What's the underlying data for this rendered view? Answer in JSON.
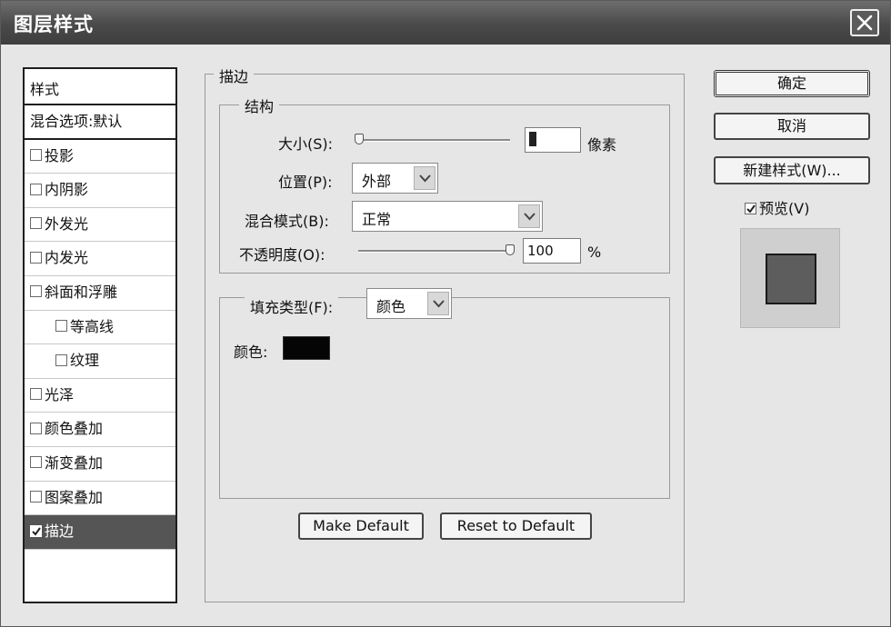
{
  "window": {
    "title": "图层样式"
  },
  "sidebar": {
    "header": "样式",
    "blend_options": "混合选项:默认",
    "items": [
      {
        "label": "投影",
        "checked": false
      },
      {
        "label": "内阴影",
        "checked": false
      },
      {
        "label": "外发光",
        "checked": false
      },
      {
        "label": "内发光",
        "checked": false
      },
      {
        "label": "斜面和浮雕",
        "checked": false
      },
      {
        "label": "等高线",
        "checked": false
      },
      {
        "label": "纹理",
        "checked": false
      },
      {
        "label": "光泽",
        "checked": false
      },
      {
        "label": "颜色叠加",
        "checked": false
      },
      {
        "label": "渐变叠加",
        "checked": false
      },
      {
        "label": "图案叠加",
        "checked": false
      },
      {
        "label": "描边",
        "checked": true
      }
    ]
  },
  "stroke": {
    "group_title": "描边",
    "structure": {
      "title": "结构",
      "size_label": "大小(S):",
      "size_value": "",
      "size_unit": "像素",
      "position_label": "位置(P):",
      "position_value": "外部",
      "blend_label": "混合模式(B):",
      "blend_value": "正常",
      "opacity_label": "不透明度(O):",
      "opacity_value": "100",
      "opacity_unit": "%"
    },
    "fill": {
      "type_label": "填充类型(F):",
      "type_value": "颜色",
      "color_label": "颜色:",
      "color_hex": "#050505"
    },
    "make_default": "Make Default",
    "reset_default": "Reset to Default"
  },
  "actions": {
    "ok": "确定",
    "cancel": "取消",
    "new_style": "新建样式(W)...",
    "preview_label": "预览(V)",
    "preview_checked": true
  },
  "icons": {
    "close": "close-icon",
    "dropdown": "chevron-down-icon",
    "check": "check-icon"
  }
}
